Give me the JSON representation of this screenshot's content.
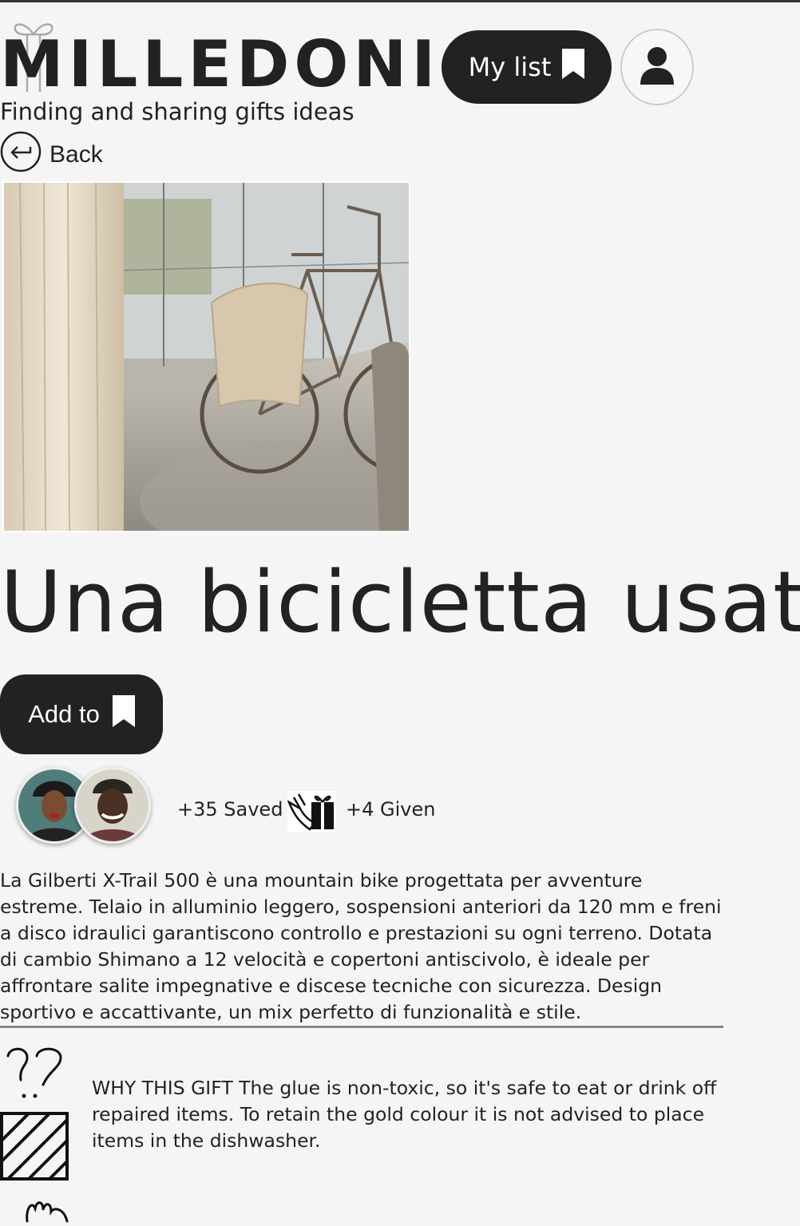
{
  "header": {
    "logo": "MILLEDONI",
    "my_list_label": "My list",
    "tagline": "Finding and sharing gifts ideas"
  },
  "nav": {
    "back_label": "Back"
  },
  "product": {
    "title": "Una bicicletta usata",
    "add_to_label": "Add to",
    "saved_text": "+35 Saved",
    "given_text": "+4 Given",
    "description": "La Gilberti X-Trail 500 è una mountain bike progettata per avventure estreme. Telaio in alluminio leggero, sospensioni anteriori da 120 mm e freni a disco idraulici garantiscono controllo e prestazioni su ogni terreno. Dotata di cambio Shimano a 12 velocità e copertoni antiscivolo, è ideale per affrontare salite impegnative e discese tecniche con sicurezza. Design sportivo e accattivante, un mix perfetto di funzionalità e stile."
  },
  "why_section": {
    "text": "WHY THIS GIFT The glue is non-toxic, so it's safe to eat or drink off repaired items. To retain the gold colour it is not advised to place items in the dishwasher."
  },
  "icons": [
    "gift-outline-icon",
    "bookmark-icon",
    "user-icon",
    "back-arrow-icon",
    "gift-hand-icon",
    "question-marks-icon",
    "hatched-box-icon",
    "hand-doodle-icon"
  ],
  "colors": {
    "background": "#f5f5f5",
    "dark": "#222222",
    "accent_white": "#ffffff"
  }
}
